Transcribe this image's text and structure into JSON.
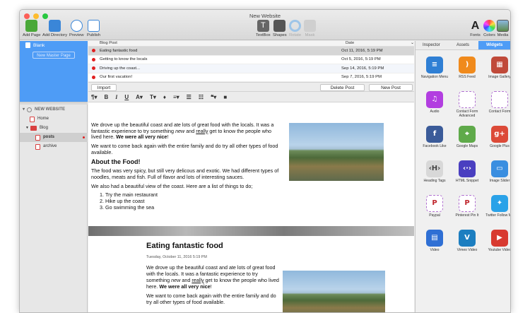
{
  "window": {
    "title": "New Website"
  },
  "toolbar": {
    "left": [
      {
        "label": "Add Page",
        "icon": "add-page-icon",
        "color": "#4aa838"
      },
      {
        "label": "Add Directory",
        "icon": "add-directory-icon",
        "color": "#3a86d8"
      },
      {
        "label": "Preview",
        "icon": "preview-eye-icon",
        "color": "#3a86d8"
      },
      {
        "label": "Publish",
        "icon": "publish-icon",
        "color": "#3a86d8"
      }
    ],
    "center": [
      {
        "label": "TextBox",
        "icon": "textbox-icon"
      },
      {
        "label": "Shapes",
        "icon": "shapes-icon"
      },
      {
        "label": "Rotate",
        "icon": "rotate-icon"
      },
      {
        "label": "Mask",
        "icon": "mask-icon"
      }
    ],
    "right": [
      {
        "label": "Fonts",
        "icon": "fonts-icon"
      },
      {
        "label": "Colors",
        "icon": "colors-icon"
      },
      {
        "label": "Media",
        "icon": "media-icon"
      }
    ]
  },
  "masters": {
    "blank_label": "Blank",
    "new_master_label": "New Master Page"
  },
  "site_tree": {
    "site_name": "NEW WEBSITE",
    "items": [
      {
        "label": "Home"
      },
      {
        "label": "Blog"
      },
      {
        "label": "posts"
      },
      {
        "label": "archive"
      }
    ]
  },
  "blog_list": {
    "col_title": "Blog Post",
    "col_date": "Date",
    "rows": [
      {
        "title": "Eating fantastic food",
        "date": "Oct 11, 2016, 5:19 PM"
      },
      {
        "title": "Getting to know the locals",
        "date": "Oct 5, 2016, 5:19 PM"
      },
      {
        "title": "Driving up the coast...",
        "date": "Sep 14, 2016, 5:19 PM"
      },
      {
        "title": "Our first vacation!",
        "date": "Sep 7, 2016, 5:19 PM"
      }
    ],
    "import_label": "Import",
    "delete_label": "Delete Post",
    "new_label": "New Post"
  },
  "editor": {
    "p1_a": "We drove up the beautiful coast and ate lots of great food with the locals. It was a fantastic experience to try something ",
    "p1_em": "new",
    "p1_b": " and ",
    "p1_u": "really",
    "p1_c": " get to know the people who lived here. ",
    "p1_strong": "We were all very nice",
    "p1_d": "!",
    "p2": "We want to come back again with the entire family and do try all other types of food available.",
    "h": "About the Food!",
    "p3": "The food was very spicy, but still very delicous and exotic. We had different types of noodles, meats and fish. Full of flavor and lots of interesting sauces.",
    "p4": "We also had a beautiful view of the coast. Here are a list of things to do;",
    "list": [
      "Try the main restaurant",
      "Hike up the coast",
      "Go swimming the sea"
    ]
  },
  "preview": {
    "title": "Eating fantastic food",
    "date": "Tuesday, October 11, 2016 5:19 PM",
    "p1_a": "We drove up the beautiful coast and ate lots of great food with the locals. It was a fantastic experience to try something ",
    "p1_em": "new",
    "p1_b": " and ",
    "p1_u": "really",
    "p1_c": " get to know the people who lived here. ",
    "p1_strong": "We were all very nice",
    "p1_d": "!",
    "p2": "We want to come back again with the entire family and do try all other types of food available."
  },
  "inspector_tabs": [
    {
      "label": "Inspector"
    },
    {
      "label": "Assets"
    },
    {
      "label": "Widgets"
    }
  ],
  "widgets": [
    {
      "label": "Navigation Menu",
      "icon": "navigation-menu-icon",
      "color": "#2f7fd4",
      "glyph": "≡"
    },
    {
      "label": "RSS Feed",
      "icon": "rss-feed-icon",
      "color": "#f08a1c",
      "glyph": ")"
    },
    {
      "label": "Image Gallery",
      "icon": "image-gallery-icon",
      "color": "#c04a3a",
      "glyph": "▦"
    },
    {
      "label": "Audio",
      "icon": "audio-icon",
      "color": "#b23ee0",
      "glyph": "♫"
    },
    {
      "label": "Contact Form Advanced",
      "icon": "contact-form-advanced-icon",
      "color": "#ffffff",
      "glyph": ""
    },
    {
      "label": "Contact Form",
      "icon": "contact-form-icon",
      "color": "#ffffff",
      "glyph": ""
    },
    {
      "label": "Facebook Like",
      "icon": "facebook-icon",
      "color": "#3b5b99",
      "glyph": "f"
    },
    {
      "label": "Google Maps",
      "icon": "google-maps-icon",
      "color": "#5faa4a",
      "glyph": "⌖"
    },
    {
      "label": "Google Plus",
      "icon": "google-plus-icon",
      "color": "#dc4a38",
      "glyph": "g+"
    },
    {
      "label": "Heading Tags",
      "icon": "heading-tags-icon",
      "color": "#d8d8d8",
      "glyph": "‹H›"
    },
    {
      "label": "HTML Snippet",
      "icon": "html-snippet-icon",
      "color": "#4a3fc0",
      "glyph": "‹·›"
    },
    {
      "label": "Image Slider",
      "icon": "image-slider-icon",
      "color": "#3a8ee0",
      "glyph": "▭"
    },
    {
      "label": "Paypal",
      "icon": "paypal-icon",
      "color": "#ffffff",
      "glyph": "P"
    },
    {
      "label": "Pinterest Pin It",
      "icon": "pinterest-icon",
      "color": "#ffffff",
      "glyph": "P"
    },
    {
      "label": "Twitter Follow Me",
      "icon": "twitter-icon",
      "color": "#2aa2e8",
      "glyph": "✦"
    },
    {
      "label": "Video",
      "icon": "video-icon",
      "color": "#2f6fd4",
      "glyph": "▤"
    },
    {
      "label": "Vimeo Video",
      "icon": "vimeo-icon",
      "color": "#1c7ec0",
      "glyph": "V"
    },
    {
      "label": "Youtube Video",
      "icon": "youtube-icon",
      "color": "#d83a30",
      "glyph": "▶"
    }
  ]
}
